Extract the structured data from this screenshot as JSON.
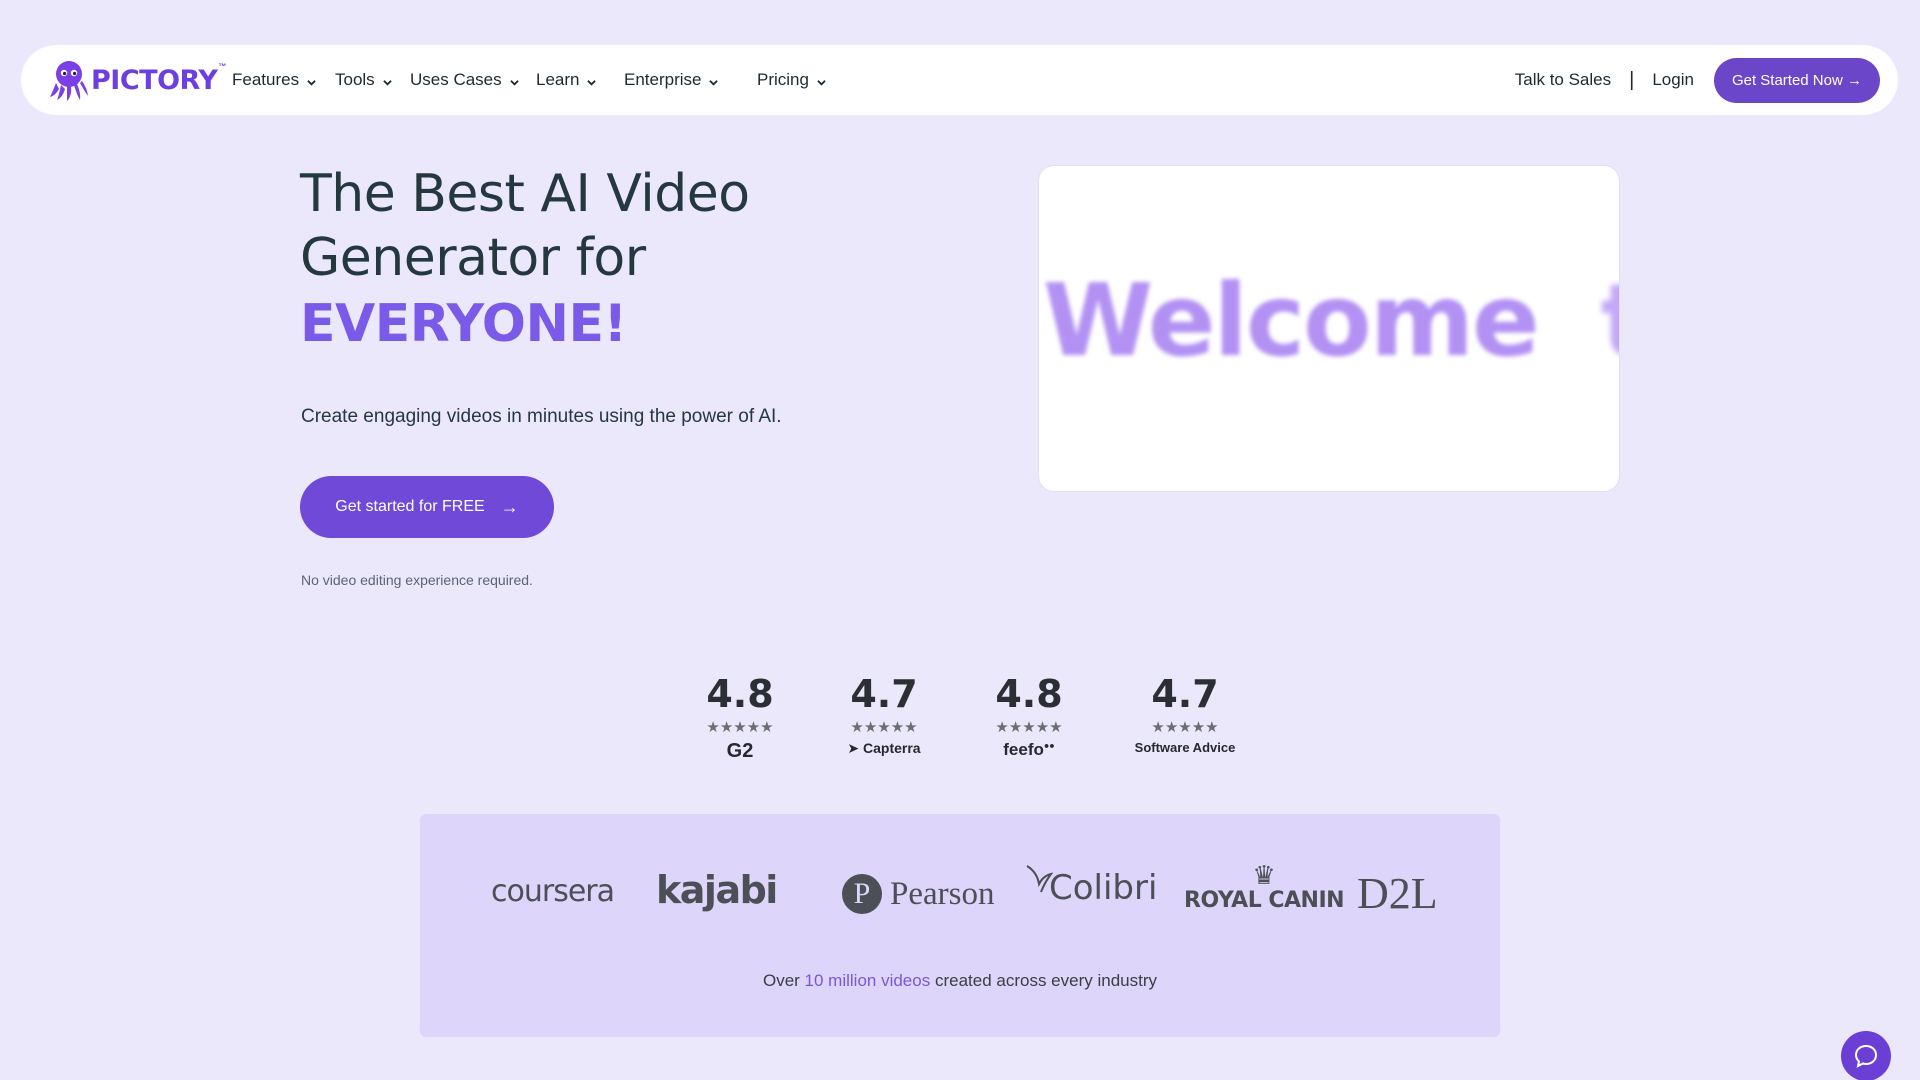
{
  "brand": {
    "name": "PICTORY",
    "tm": "™",
    "color": "#6d3fe0"
  },
  "nav": {
    "items": [
      {
        "label": "Features"
      },
      {
        "label": "Tools"
      },
      {
        "label": "Uses Cases"
      },
      {
        "label": "Learn"
      },
      {
        "label": "Enterprise"
      },
      {
        "label": "Pricing"
      }
    ],
    "talk_to_sales": "Talk to Sales",
    "separator": "|",
    "login": "Login",
    "cta": "Get Started Now →"
  },
  "hero": {
    "title_line1": "The Best AI Video",
    "title_line2": "Generator for",
    "title_accent": "EVERYONE!",
    "subtitle": "Create engaging videos in minutes using the power of AI.",
    "button_label": "Get started for FREE",
    "button_arrow": "→",
    "note": "No video editing experience required."
  },
  "video": {
    "text_main": "Welcome",
    "text_tail": "to"
  },
  "ratings": [
    {
      "score": "4.8",
      "stars": "★★★★★",
      "source": "G2"
    },
    {
      "score": "4.7",
      "stars": "★★★★★",
      "source": "Capterra"
    },
    {
      "score": "4.8",
      "stars": "★★★★★",
      "source": "feefo"
    },
    {
      "score": "4.7",
      "stars": "★★★★★",
      "source": "Software Advice"
    }
  ],
  "clients": {
    "logos": [
      "coursera",
      "kajabi",
      "Pearson",
      "Colibri",
      "ROYAL CANIN",
      "D2L"
    ],
    "caption_prefix": "Over ",
    "caption_highlight": "10 million videos",
    "caption_suffix": " created across every industry"
  },
  "colors": {
    "accent": "#7049d8",
    "background": "#ece8fc",
    "panel": "#ded5fb"
  },
  "icons": {
    "chat": "chat-bubble-icon",
    "chevron": "chevron-down-icon"
  }
}
